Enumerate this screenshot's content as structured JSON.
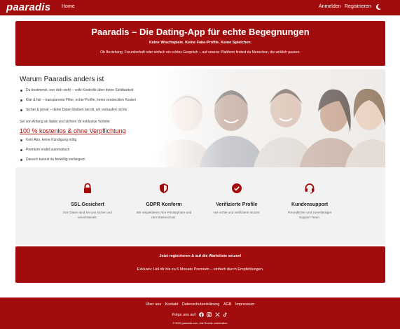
{
  "nav": {
    "logo": "paaradis",
    "home": "Home",
    "login": "Anmelden",
    "register": "Registrieren",
    "theme_icon": "moon-icon"
  },
  "hero": {
    "title": "Paaradis – Die Dating-App für echte Begegnungen",
    "subtitle": "Keine Wischspiele. Keine Fake-Profile. Keine Spielchen.",
    "text": "Ob Beziehung, Freundschaft oder einfach ein echtes Gespräch – auf unserer Plattform findest du Menschen, die wirklich passen."
  },
  "why": {
    "title": "Warum Paaradis anders ist",
    "points": [
      "Du bestimmst, wer dich sieht – volle Kontrolle über deine Sichtbarkeit",
      "Klar & fair – transparente Filter, echte Profile, keine versteckten Kosten",
      "Sicher & privat – deine Daten bleiben bei dir, wir verkaufen nichts"
    ],
    "intro": "Sei von Anfang an dabei und sichere dir exklusive Vorteile:",
    "free_heading": "100 % kostenlos & ohne Verpflichtung",
    "free_points": [
      "Kein Abo, keine Kündigung nötig",
      "Premium endet automatisch",
      "Danach kannst du freiwillig verlängern"
    ]
  },
  "features": [
    {
      "icon": "lock-icon",
      "title": "SSL Gesichert",
      "desc": "Ihre Daten sind bei uns sicher und verschlüsselt."
    },
    {
      "icon": "shield-icon",
      "title": "GDPR Konform",
      "desc": "Wir respektieren Ihre Privatsphäre und den Datenschutz."
    },
    {
      "icon": "check-circle-icon",
      "title": "Verifizierte Profile",
      "desc": "Nur echte und verifizierte Nutzer."
    },
    {
      "icon": "headset-icon",
      "title": "Kundensupport",
      "desc": "Freundlicher und zuverlässiger Support-Team."
    }
  ],
  "cta": {
    "link": "Jetzt registrieren & auf die Warteliste setzen!",
    "text": "Exklusiv: Hol dir bis zu 6 Monate Premium – einfach durch Empfehlungen."
  },
  "footer": {
    "links": [
      "Über uns",
      "Kontakt",
      "Datenschutzerklärung",
      "AGB",
      "Impressum"
    ],
    "follow": "Folge uns auf",
    "social_icons": [
      "facebook-icon",
      "instagram-icon",
      "x-icon",
      "tiktok-icon"
    ],
    "copyright": "© 2025 paaradis.com. Alle Rechte vorbehalten"
  },
  "colors": {
    "brand": "#a20c0c",
    "panel": "#f2f2f2"
  }
}
